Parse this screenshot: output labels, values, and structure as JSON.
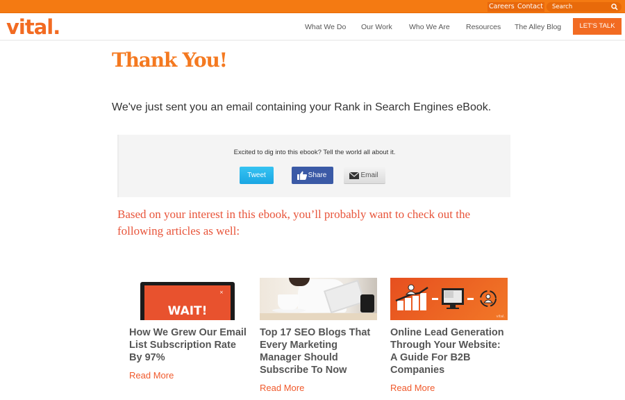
{
  "topbar": {
    "careers": "Careers",
    "contact": "Contact",
    "search_placeholder": "Search"
  },
  "header": {
    "logo": "vital.",
    "nav": [
      "What We Do",
      "Our Work",
      "Who We Are",
      "Resources",
      "The Alley Blog"
    ],
    "cta": "LET'S TALK"
  },
  "main": {
    "title": "Thank You!",
    "intro": "We've just sent you an email containing your Rank in Search Engines eBook.",
    "share": {
      "prompt": "Excited to dig into this ebook? Tell the world all about it.",
      "tweet": "Tweet",
      "share": "Share",
      "email": "Email"
    },
    "suggest": "Based on your interest in this ebook, you’ll probably want to check out the following articles as well:",
    "articles": [
      {
        "image_text": "WAIT!",
        "title": "How We Grew Our Email List Subscription Rate By 97%",
        "link": "Read More"
      },
      {
        "title": "Top 17 SEO Blogs That Every Marketing Manager Should Subscribe To Now",
        "link": "Read More"
      },
      {
        "image_text": "vital.",
        "title": "Online Lead Generation Through Your Website: A Guide For B2B Companies",
        "link": "Read More"
      }
    ]
  },
  "colors": {
    "brand_orange": "#f47a12",
    "accent": "#f26b22",
    "link_red": "#f0592b",
    "tweet_blue": "#1aa6e3",
    "facebook_blue": "#3b5aa6"
  }
}
